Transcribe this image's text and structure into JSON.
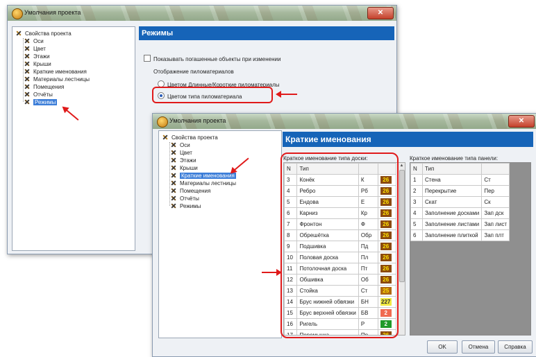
{
  "dialog1": {
    "title": "Умолчания проекта",
    "close_label": "✕",
    "tree": {
      "root": "Свойства проекта",
      "items": [
        "Оси",
        "Цвет",
        "Этажи",
        "Крыши",
        "Краткие именования",
        "Материалы лестницы",
        "Помещения",
        "Отчёты",
        "Режимы"
      ],
      "selected": "Режимы"
    },
    "header": "Режимы",
    "show_repaid_label": "Показывать погашенные объекты при изменении",
    "lumber_display_label": "Отображение пиломатериалов",
    "radio_options": [
      "Цветом Длинные/Короткие пиломатериалы",
      "Цветом типа пиломатериала"
    ],
    "radio_selected_index": 1
  },
  "dialog2": {
    "title": "Умолчания проекта",
    "close_label": "✕",
    "tree": {
      "root": "Свойства проекта",
      "items": [
        "Оси",
        "Цвет",
        "Этажи",
        "Крыши",
        "Краткие именования",
        "Материалы лестницы",
        "Помещения",
        "Отчёты",
        "Режимы"
      ],
      "selected": "Краткие именования"
    },
    "header": "Краткие именования",
    "board_table": {
      "caption": "Краткое именование типа доски:",
      "headers": [
        "N",
        "Тип",
        "",
        ""
      ],
      "rows": [
        {
          "n": "3",
          "type": "Конёк",
          "short": "К",
          "code": "26",
          "color": "#8b4a10",
          "text": "#ffe000"
        },
        {
          "n": "4",
          "type": "Ребро",
          "short": "Рб",
          "code": "26",
          "color": "#8b4a10",
          "text": "#ffe000"
        },
        {
          "n": "5",
          "type": "Ендова",
          "short": "Е",
          "code": "26",
          "color": "#8b4a10",
          "text": "#ffe000"
        },
        {
          "n": "6",
          "type": "Карниз",
          "short": "Кр",
          "code": "26",
          "color": "#8b4a10",
          "text": "#ffe000"
        },
        {
          "n": "7",
          "type": "Фронтон",
          "short": "Ф",
          "code": "26",
          "color": "#8b4a10",
          "text": "#ffe000"
        },
        {
          "n": "8",
          "type": "Обрешётка",
          "short": "Обр",
          "code": "26",
          "color": "#8b4a10",
          "text": "#ffe000"
        },
        {
          "n": "9",
          "type": "Подшивка",
          "short": "Пд",
          "code": "26",
          "color": "#8b4a10",
          "text": "#ffe000"
        },
        {
          "n": "10",
          "type": "Половая доска",
          "short": "Пл",
          "code": "26",
          "color": "#8b4a10",
          "text": "#ffe000"
        },
        {
          "n": "11",
          "type": "Потолочная доска",
          "short": "Пт",
          "code": "26",
          "color": "#8b4a10",
          "text": "#ffe000"
        },
        {
          "n": "12",
          "type": "Обшивка",
          "short": "Об",
          "code": "26",
          "color": "#8b4a10",
          "text": "#ffe000"
        },
        {
          "n": "13",
          "type": "Стойка",
          "short": "Ст",
          "code": "25",
          "color": "#b06a10",
          "text": "#ffe000"
        },
        {
          "n": "14",
          "type": "Брус нижней обвязки",
          "short": "БН",
          "code": "227",
          "color": "#f0e840",
          "text": "#333333"
        },
        {
          "n": "15",
          "type": "Брус верхней обвязки",
          "short": "БВ",
          "code": "2",
          "color": "#f06a50",
          "text": "#ffffff"
        },
        {
          "n": "16",
          "type": "Ригель",
          "short": "Р",
          "code": "2",
          "color": "#1f9a2a",
          "text": "#ffffff"
        },
        {
          "n": "17",
          "type": "Перемычка",
          "short": "Пр",
          "code": "26",
          "color": "#8b4a10",
          "text": "#ffe000"
        }
      ]
    },
    "panel_table": {
      "caption": "Краткое именование типа панели:",
      "headers": [
        "N",
        "Тип",
        ""
      ],
      "rows": [
        {
          "n": "1",
          "type": "Стена",
          "short": "Ст"
        },
        {
          "n": "2",
          "type": "Перекрытие",
          "short": "Пер"
        },
        {
          "n": "3",
          "type": "Скат",
          "short": "Ск"
        },
        {
          "n": "4",
          "type": "Заполнение досками",
          "short": "Зап дск"
        },
        {
          "n": "5",
          "type": "Заполнение листами",
          "short": "Зап лист"
        },
        {
          "n": "6",
          "type": "Заполнение плиткой",
          "short": "Зап плт"
        }
      ]
    },
    "buttons": {
      "ok": "OK",
      "cancel": "Отмена",
      "help": "Справка"
    }
  },
  "colors": {
    "header_blue": "#1664b8",
    "highlight_red": "#e01a1a",
    "selection_blue": "#3b7dd8"
  }
}
